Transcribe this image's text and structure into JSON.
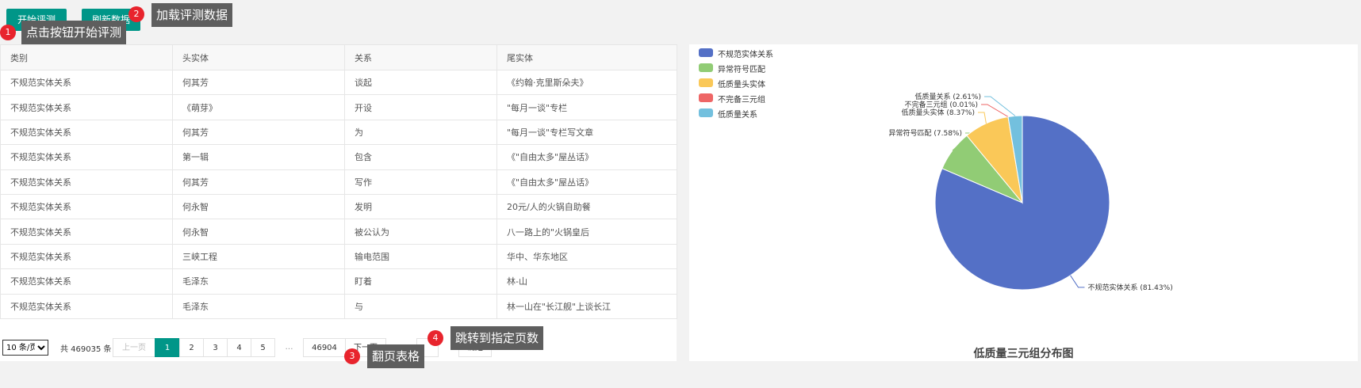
{
  "toolbar": {
    "start_label": "开始评测",
    "refresh_label": "刷新数据"
  },
  "tooltips": [
    {
      "num": "1",
      "text": "点击按钮开始评测"
    },
    {
      "num": "2",
      "text": "加载评测数据"
    },
    {
      "num": "3",
      "text": "翻页表格"
    },
    {
      "num": "4",
      "text": "跳转到指定页数"
    }
  ],
  "table": {
    "headers": [
      "类别",
      "头实体",
      "关系",
      "尾实体"
    ],
    "rows": [
      [
        "不规范实体关系",
        "何其芳",
        "谈起",
        "《约翰·克里斯朵夫》"
      ],
      [
        "不规范实体关系",
        "《萌芽》",
        "开设",
        "\"每月一谈\"专栏"
      ],
      [
        "不规范实体关系",
        "何其芳",
        "为",
        "\"每月一谈\"专栏写文章"
      ],
      [
        "不规范实体关系",
        "第一辑",
        "包含",
        "《\"自由太多\"屋丛话》"
      ],
      [
        "不规范实体关系",
        "何其芳",
        "写作",
        "《\"自由太多\"屋丛话》"
      ],
      [
        "不规范实体关系",
        "何永智",
        "发明",
        "20元/人的火锅自助餐"
      ],
      [
        "不规范实体关系",
        "何永智",
        "被公认为",
        "八一路上的\"火锅皇后"
      ],
      [
        "不规范实体关系",
        "三峡工程",
        "输电范围",
        "华中、华东地区"
      ],
      [
        "不规范实体关系",
        "毛泽东",
        "盯着",
        "林-山"
      ],
      [
        "不规范实体关系",
        "毛泽东",
        "与",
        "林一山在\"长江舰\"上谈长江"
      ]
    ]
  },
  "pagination": {
    "page_size": "10 条/页",
    "total": "共 469035 条",
    "prev": "上一页",
    "pages": [
      "1",
      "2",
      "3",
      "4",
      "5"
    ],
    "ellipsis": "…",
    "last_page": "46904",
    "next": "下一页",
    "goto": "到第",
    "confirm": "确定",
    "current_page": 1
  },
  "chart_data": {
    "type": "pie",
    "title": "低质量三元组分布图",
    "legend_position": "top-left",
    "slices": [
      {
        "name": "不规范实体关系",
        "value": 81.43,
        "label": "不规范实体关系 (81.43%)",
        "color": "#5470c6"
      },
      {
        "name": "异常符号匹配",
        "value": 7.58,
        "label": "异常符号匹配 (7.58%)",
        "color": "#91cc75"
      },
      {
        "name": "低质量头实体",
        "value": 8.37,
        "label": "低质量头实体 (8.37%)",
        "color": "#fac858"
      },
      {
        "name": "不完备三元组",
        "value": 0.01,
        "label": "不完备三元组 (0.01%)",
        "color": "#ee6666"
      },
      {
        "name": "低质量关系",
        "value": 2.61,
        "label": "低质量关系 (2.61%)",
        "color": "#73c0de"
      }
    ]
  }
}
